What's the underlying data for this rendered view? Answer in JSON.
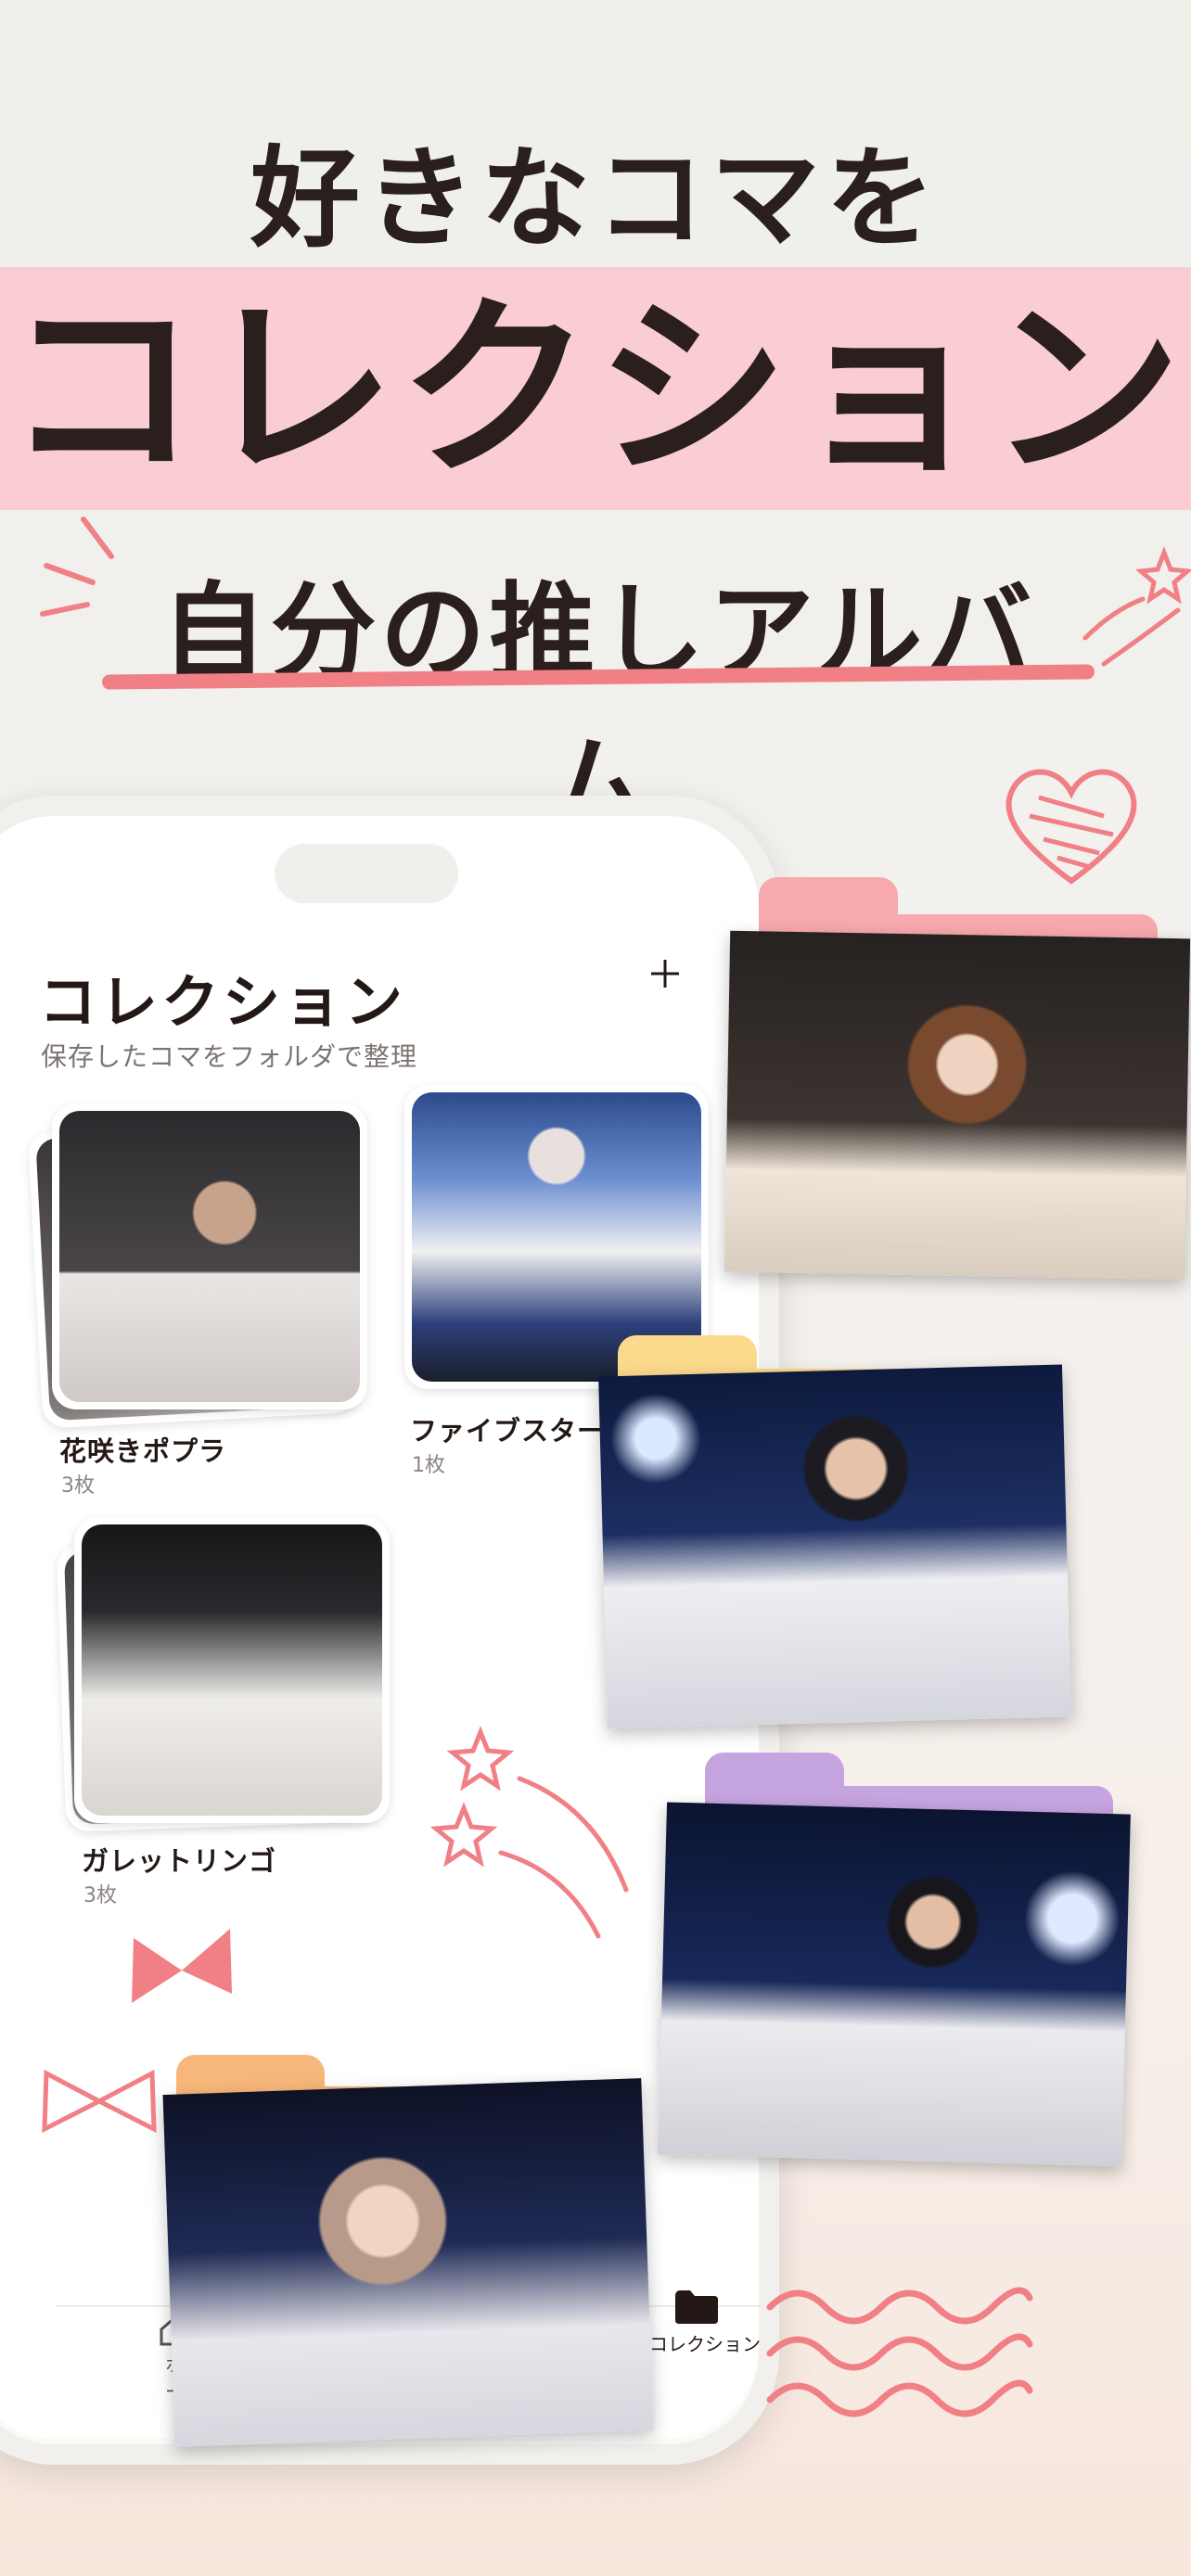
{
  "headline": "好きなコマを",
  "banner": "コレクション",
  "subline": "自分の推しアルバム",
  "screen": {
    "title": "コレクション",
    "subtitle": "保存したコマをフォルダで整理",
    "add_icon": "plus-icon",
    "albums": [
      {
        "name": "花咲きポプラ",
        "count": "3枚"
      },
      {
        "name": "ファイブスター",
        "count": "1枚"
      },
      {
        "name": "ガレットリンゴ",
        "count": "3枚"
      }
    ],
    "tabbar": {
      "home_label": "ホー",
      "collection_label": "コレクション"
    }
  },
  "colors": {
    "band": "#f9cdd3",
    "accent_pink": "#f17f86",
    "folder_pink": "#f7a9ad",
    "folder_yellow": "#fbd98d",
    "folder_purple": "#c6a4e0",
    "folder_orange": "#f7b77a"
  }
}
